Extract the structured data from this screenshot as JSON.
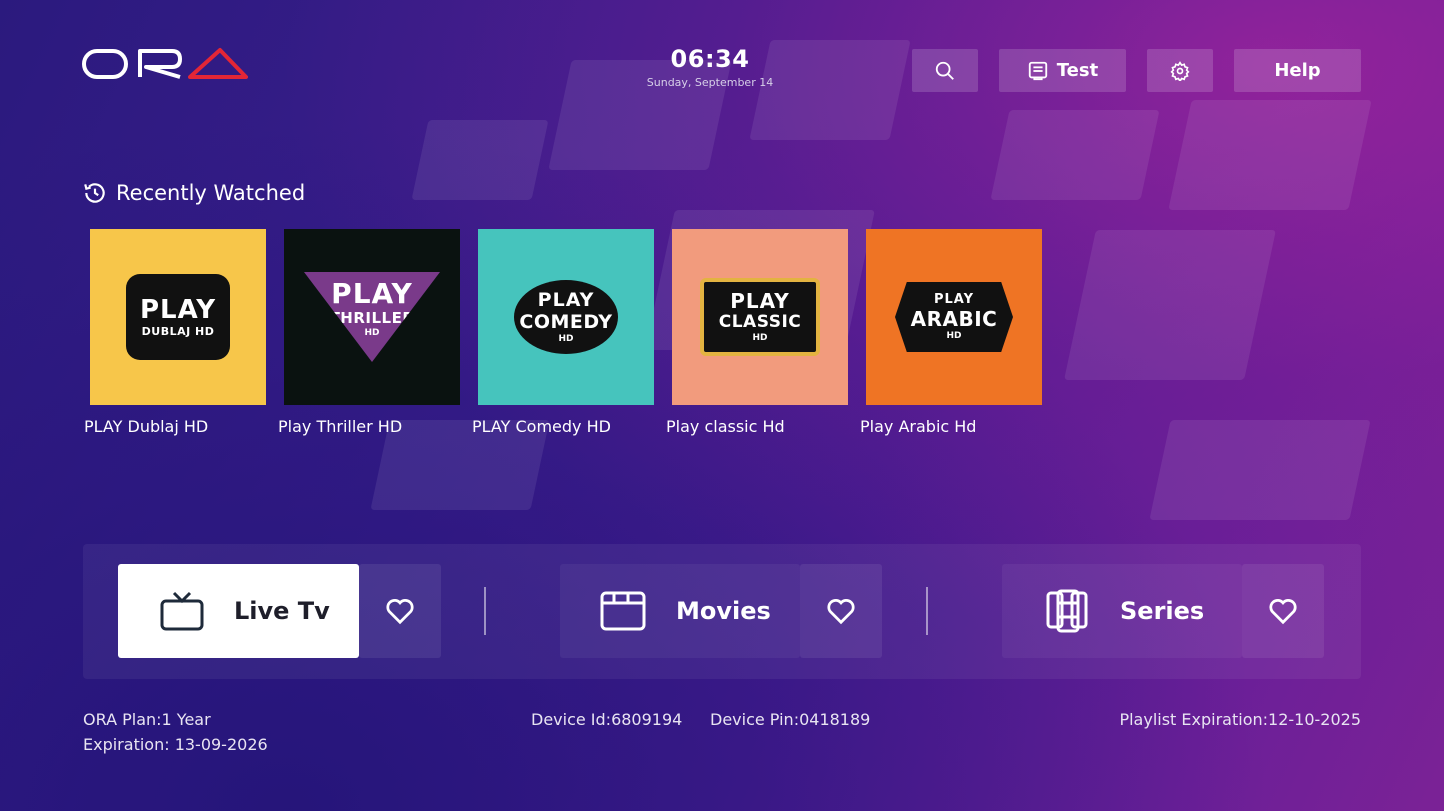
{
  "app": {
    "brand": "ORA",
    "brand_accent_color": "#e32636"
  },
  "header": {
    "time": "06:34",
    "date": "Sunday, September 14",
    "buttons": [
      {
        "icon": "search-icon",
        "label": ""
      },
      {
        "icon": "playlist-icon",
        "label": "Test"
      },
      {
        "icon": "gear-icon",
        "label": ""
      },
      {
        "icon": "",
        "label": "Help"
      }
    ]
  },
  "recently_watched": {
    "title": "Recently Watched",
    "items": [
      {
        "name": "PLAY Dublaj HD",
        "logo_line1": "PLAY",
        "logo_line2": "DUBLAJ HD",
        "logo_line3": "",
        "bg": "#f7c64a"
      },
      {
        "name": "Play Thriller HD",
        "logo_line1": "PLAY",
        "logo_line2": "THRILLER",
        "logo_line3": "HD",
        "bg": "#0a1210"
      },
      {
        "name": "PLAY Comedy HD",
        "logo_line1": "PLAY",
        "logo_line2": "COMEDY",
        "logo_line3": "HD",
        "bg": "#46c4bd"
      },
      {
        "name": "Play classic Hd",
        "logo_line1": "PLAY",
        "logo_line2": "CLASSIC",
        "logo_line3": "HD",
        "bg": "#f29b7d"
      },
      {
        "name": "Play Arabic Hd",
        "logo_line1": "PLAY",
        "logo_line2": "ARABIC",
        "logo_line3": "HD",
        "bg": "#ef7424"
      }
    ]
  },
  "menu": {
    "live": {
      "label": "Live Tv",
      "icon": "tv-icon"
    },
    "movies": {
      "label": "Movies",
      "icon": "film-icon"
    },
    "series": {
      "label": "Series",
      "icon": "series-icon"
    },
    "fav_icon": "heart-icon"
  },
  "footer": {
    "plan": "ORA Plan:1 Year",
    "expiration": "Expiration: 13-09-2026",
    "device_id": "Device Id:6809194",
    "device_pin": "Device Pin:0418189",
    "playlist_expiration": "Playlist Expiration:12-10-2025"
  }
}
